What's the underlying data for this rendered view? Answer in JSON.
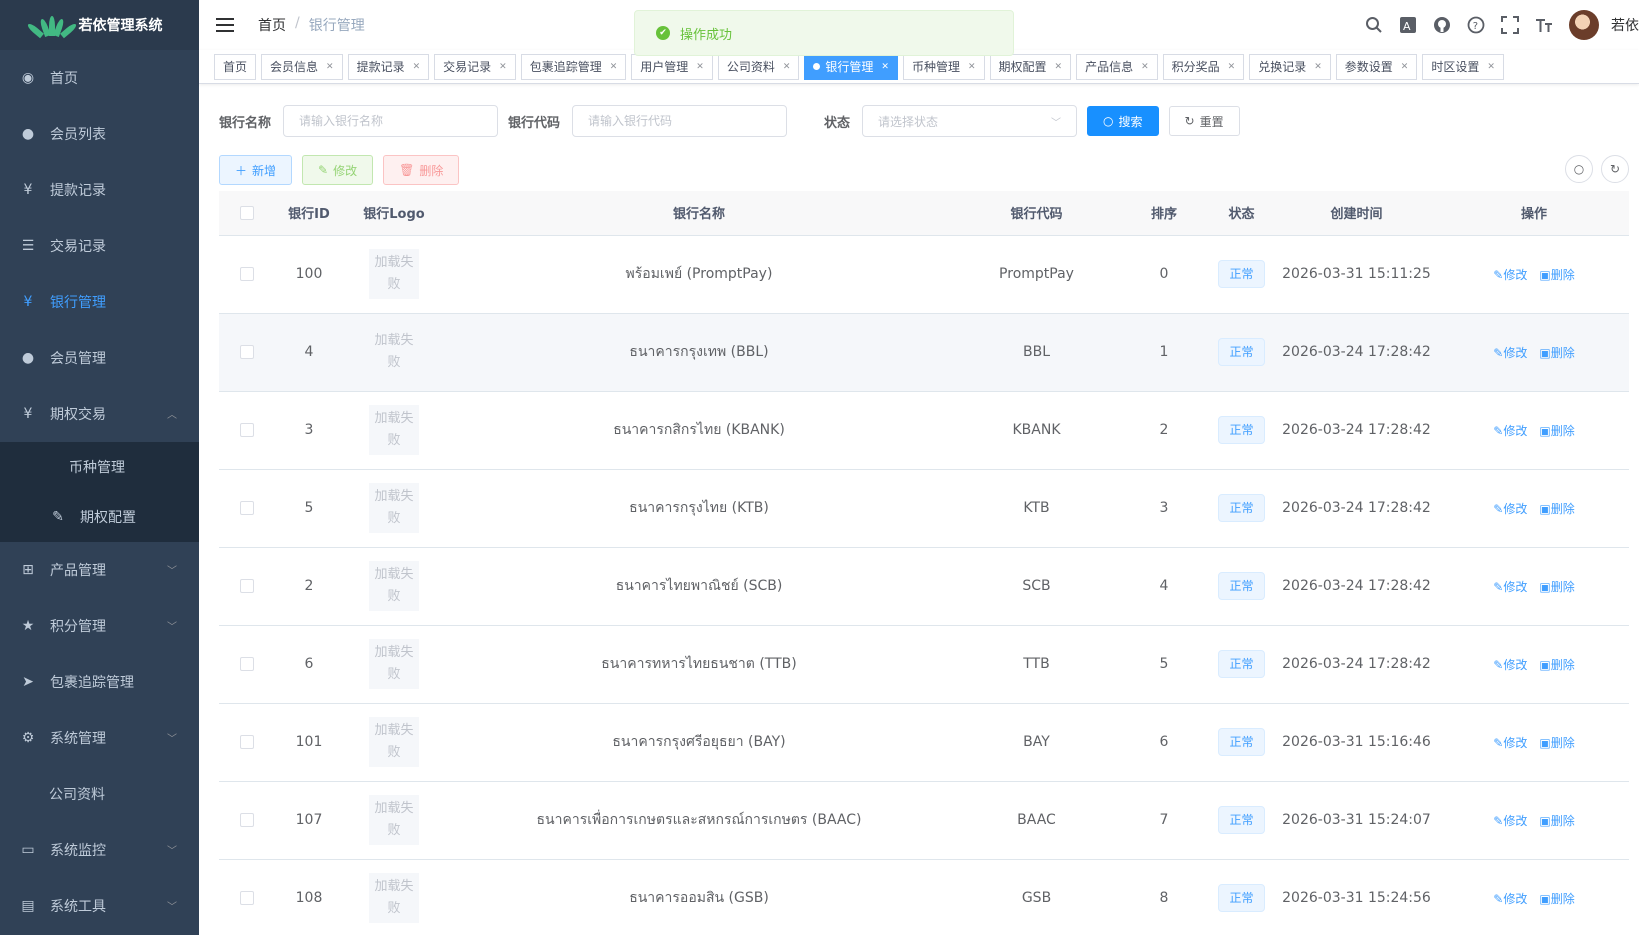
{
  "sidebar": {
    "title": "若依管理系统",
    "items": [
      {
        "icon": "dashboard-icon",
        "glyph": "◉",
        "label": "首页"
      },
      {
        "icon": "user-icon",
        "glyph": "●",
        "label": "会员列表"
      },
      {
        "icon": "yen-icon",
        "glyph": "¥",
        "label": "提款记录"
      },
      {
        "icon": "list-icon",
        "glyph": "☰",
        "label": "交易记录"
      },
      {
        "icon": "yen-icon",
        "glyph": "¥",
        "label": "银行管理"
      },
      {
        "icon": "peoples-icon",
        "glyph": "●",
        "label": "会员管理"
      },
      {
        "icon": "yen-icon",
        "glyph": "¥",
        "label": "期权交易"
      },
      {
        "icon": "",
        "glyph": "",
        "label": "币种管理"
      },
      {
        "icon": "edit-icon",
        "glyph": "✎",
        "label": "期权配置"
      },
      {
        "icon": "cart-icon",
        "glyph": "⊞",
        "label": "产品管理"
      },
      {
        "icon": "star-icon",
        "glyph": "★",
        "label": "积分管理"
      },
      {
        "icon": "send-icon",
        "glyph": "➤",
        "label": "包裹追踪管理"
      },
      {
        "icon": "gear-icon",
        "glyph": "⚙",
        "label": "系统管理"
      },
      {
        "icon": "",
        "glyph": "",
        "label": "公司资料"
      },
      {
        "icon": "monitor-icon",
        "glyph": "▭",
        "label": "系统监控"
      },
      {
        "icon": "tool-icon",
        "glyph": "▤",
        "label": "系统工具"
      }
    ]
  },
  "header": {
    "breadcrumb_home": "首页",
    "breadcrumb_sep": "/",
    "breadcrumb_current": "银行管理",
    "username": "若依",
    "icons": [
      "search-icon",
      "translate-icon",
      "github-icon",
      "question-icon",
      "fullscreen-icon",
      "font-size-icon"
    ]
  },
  "toast": {
    "message": "操作成功"
  },
  "tags": [
    {
      "label": "首页",
      "closable": false,
      "active": false
    },
    {
      "label": "会员信息",
      "closable": true,
      "active": false
    },
    {
      "label": "提款记录",
      "closable": true,
      "active": false
    },
    {
      "label": "交易记录",
      "closable": true,
      "active": false
    },
    {
      "label": "包裹追踪管理",
      "closable": true,
      "active": false
    },
    {
      "label": "用户管理",
      "closable": true,
      "active": false
    },
    {
      "label": "公司资料",
      "closable": true,
      "active": false
    },
    {
      "label": "银行管理",
      "closable": true,
      "active": true
    },
    {
      "label": "币种管理",
      "closable": true,
      "active": false
    },
    {
      "label": "期权配置",
      "closable": true,
      "active": false
    },
    {
      "label": "产品信息",
      "closable": true,
      "active": false
    },
    {
      "label": "积分奖品",
      "closable": true,
      "active": false
    },
    {
      "label": "兑换记录",
      "closable": true,
      "active": false
    },
    {
      "label": "参数设置",
      "closable": true,
      "active": false
    },
    {
      "label": "时区设置",
      "closable": true,
      "active": false
    }
  ],
  "search": {
    "bank_name_label": "银行名称",
    "bank_name_placeholder": "请输入银行名称",
    "bank_code_label": "银行代码",
    "bank_code_placeholder": "请输入银行代码",
    "status_label": "状态",
    "status_placeholder": "请选择状态",
    "search_btn": "搜索",
    "reset_btn": "重置"
  },
  "toolbar": {
    "add": "新增",
    "edit": "修改",
    "delete": "删除"
  },
  "table": {
    "columns": [
      "银行ID",
      "银行Logo",
      "银行名称",
      "银行代码",
      "排序",
      "状态",
      "创建时间",
      "操作"
    ],
    "logo_fail_text": "加载失败",
    "edit_label": "修改",
    "delete_label": "删除",
    "rows": [
      {
        "id": "100",
        "name": "พร้อมเพย์ (PromptPay)",
        "code": "PromptPay",
        "sort": "0",
        "status": "正常",
        "created": "2026-03-31 15:11:25"
      },
      {
        "id": "4",
        "name": "ธนาคารกรุงเทพ (BBL)",
        "code": "BBL",
        "sort": "1",
        "status": "正常",
        "created": "2026-03-24 17:28:42"
      },
      {
        "id": "3",
        "name": "ธนาคารกสิกรไทย (KBANK)",
        "code": "KBANK",
        "sort": "2",
        "status": "正常",
        "created": "2026-03-24 17:28:42"
      },
      {
        "id": "5",
        "name": "ธนาคารกรุงไทย (KTB)",
        "code": "KTB",
        "sort": "3",
        "status": "正常",
        "created": "2026-03-24 17:28:42"
      },
      {
        "id": "2",
        "name": "ธนาคารไทยพาณิชย์ (SCB)",
        "code": "SCB",
        "sort": "4",
        "status": "正常",
        "created": "2026-03-24 17:28:42"
      },
      {
        "id": "6",
        "name": "ธนาคารทหารไทยธนชาต (TTB)",
        "code": "TTB",
        "sort": "5",
        "status": "正常",
        "created": "2026-03-24 17:28:42"
      },
      {
        "id": "101",
        "name": "ธนาคารกรุงศรีอยุธยา (BAY)",
        "code": "BAY",
        "sort": "6",
        "status": "正常",
        "created": "2026-03-31 15:16:46"
      },
      {
        "id": "107",
        "name": "ธนาคารเพื่อการเกษตรและสหกรณ์การเกษตร (BAAC)",
        "code": "BAAC",
        "sort": "7",
        "status": "正常",
        "created": "2026-03-31 15:24:07"
      },
      {
        "id": "108",
        "name": "ธนาคารออมสิน (GSB)",
        "code": "GSB",
        "sort": "8",
        "status": "正常",
        "created": "2026-03-31 15:24:56"
      }
    ]
  },
  "colors": {
    "sidebar_bg": "#304156",
    "accent": "#409eff",
    "success": "#67c23a",
    "danger": "#f56c6c"
  }
}
